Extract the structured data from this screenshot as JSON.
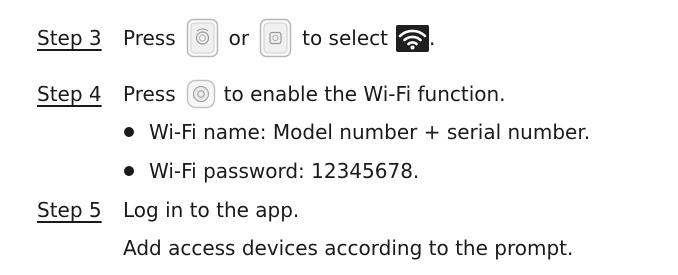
{
  "steps": [
    {
      "label": "Step 3",
      "parts": [
        "Press",
        "or",
        "to select",
        "."
      ],
      "icons": [
        "rotate-left-button-icon",
        "rotate-right-button-icon",
        "wifi-icon"
      ]
    },
    {
      "label": "Step 4",
      "parts": [
        "Press",
        "to enable the Wi-Fi function."
      ],
      "icons": [
        "confirm-button-icon"
      ],
      "bullets": [
        "Wi-Fi name: Model number + serial number.",
        "Wi-Fi password: 12345678."
      ]
    },
    {
      "label": "Step 5",
      "lines": [
        "Log in to the app.",
        "Add access devices according to the prompt."
      ]
    }
  ]
}
